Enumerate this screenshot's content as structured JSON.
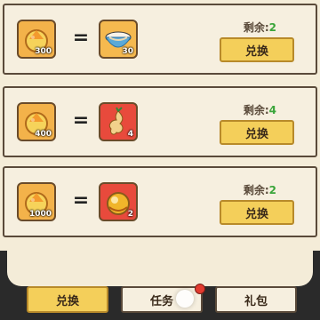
{
  "exchange": {
    "rows": [
      {
        "cost_qty": "300",
        "reward_qty": "30",
        "remain_label": "剩余:",
        "remain_value": "2",
        "button_label": "兑换"
      },
      {
        "cost_qty": "400",
        "reward_qty": "4",
        "remain_label": "剩余:",
        "remain_value": "4",
        "button_label": "兑换"
      },
      {
        "cost_qty": "1000",
        "reward_qty": "2",
        "remain_label": "剩余:",
        "remain_value": "2",
        "button_label": "兑换"
      }
    ],
    "equals": "="
  },
  "tabs": [
    {
      "label": "兑换"
    },
    {
      "label": "任务"
    },
    {
      "label": "礼包"
    }
  ],
  "colors": {
    "remain_value": "#3aa53a",
    "button_bg": "#f4cf5a",
    "badge_red": "#e23b2f"
  },
  "icons": {
    "cost": "golden-rooster-icon",
    "row1_reward": "porridge-bowl-icon",
    "row2_reward": "ginseng-icon",
    "row3_reward": "golden-orb-icon"
  }
}
